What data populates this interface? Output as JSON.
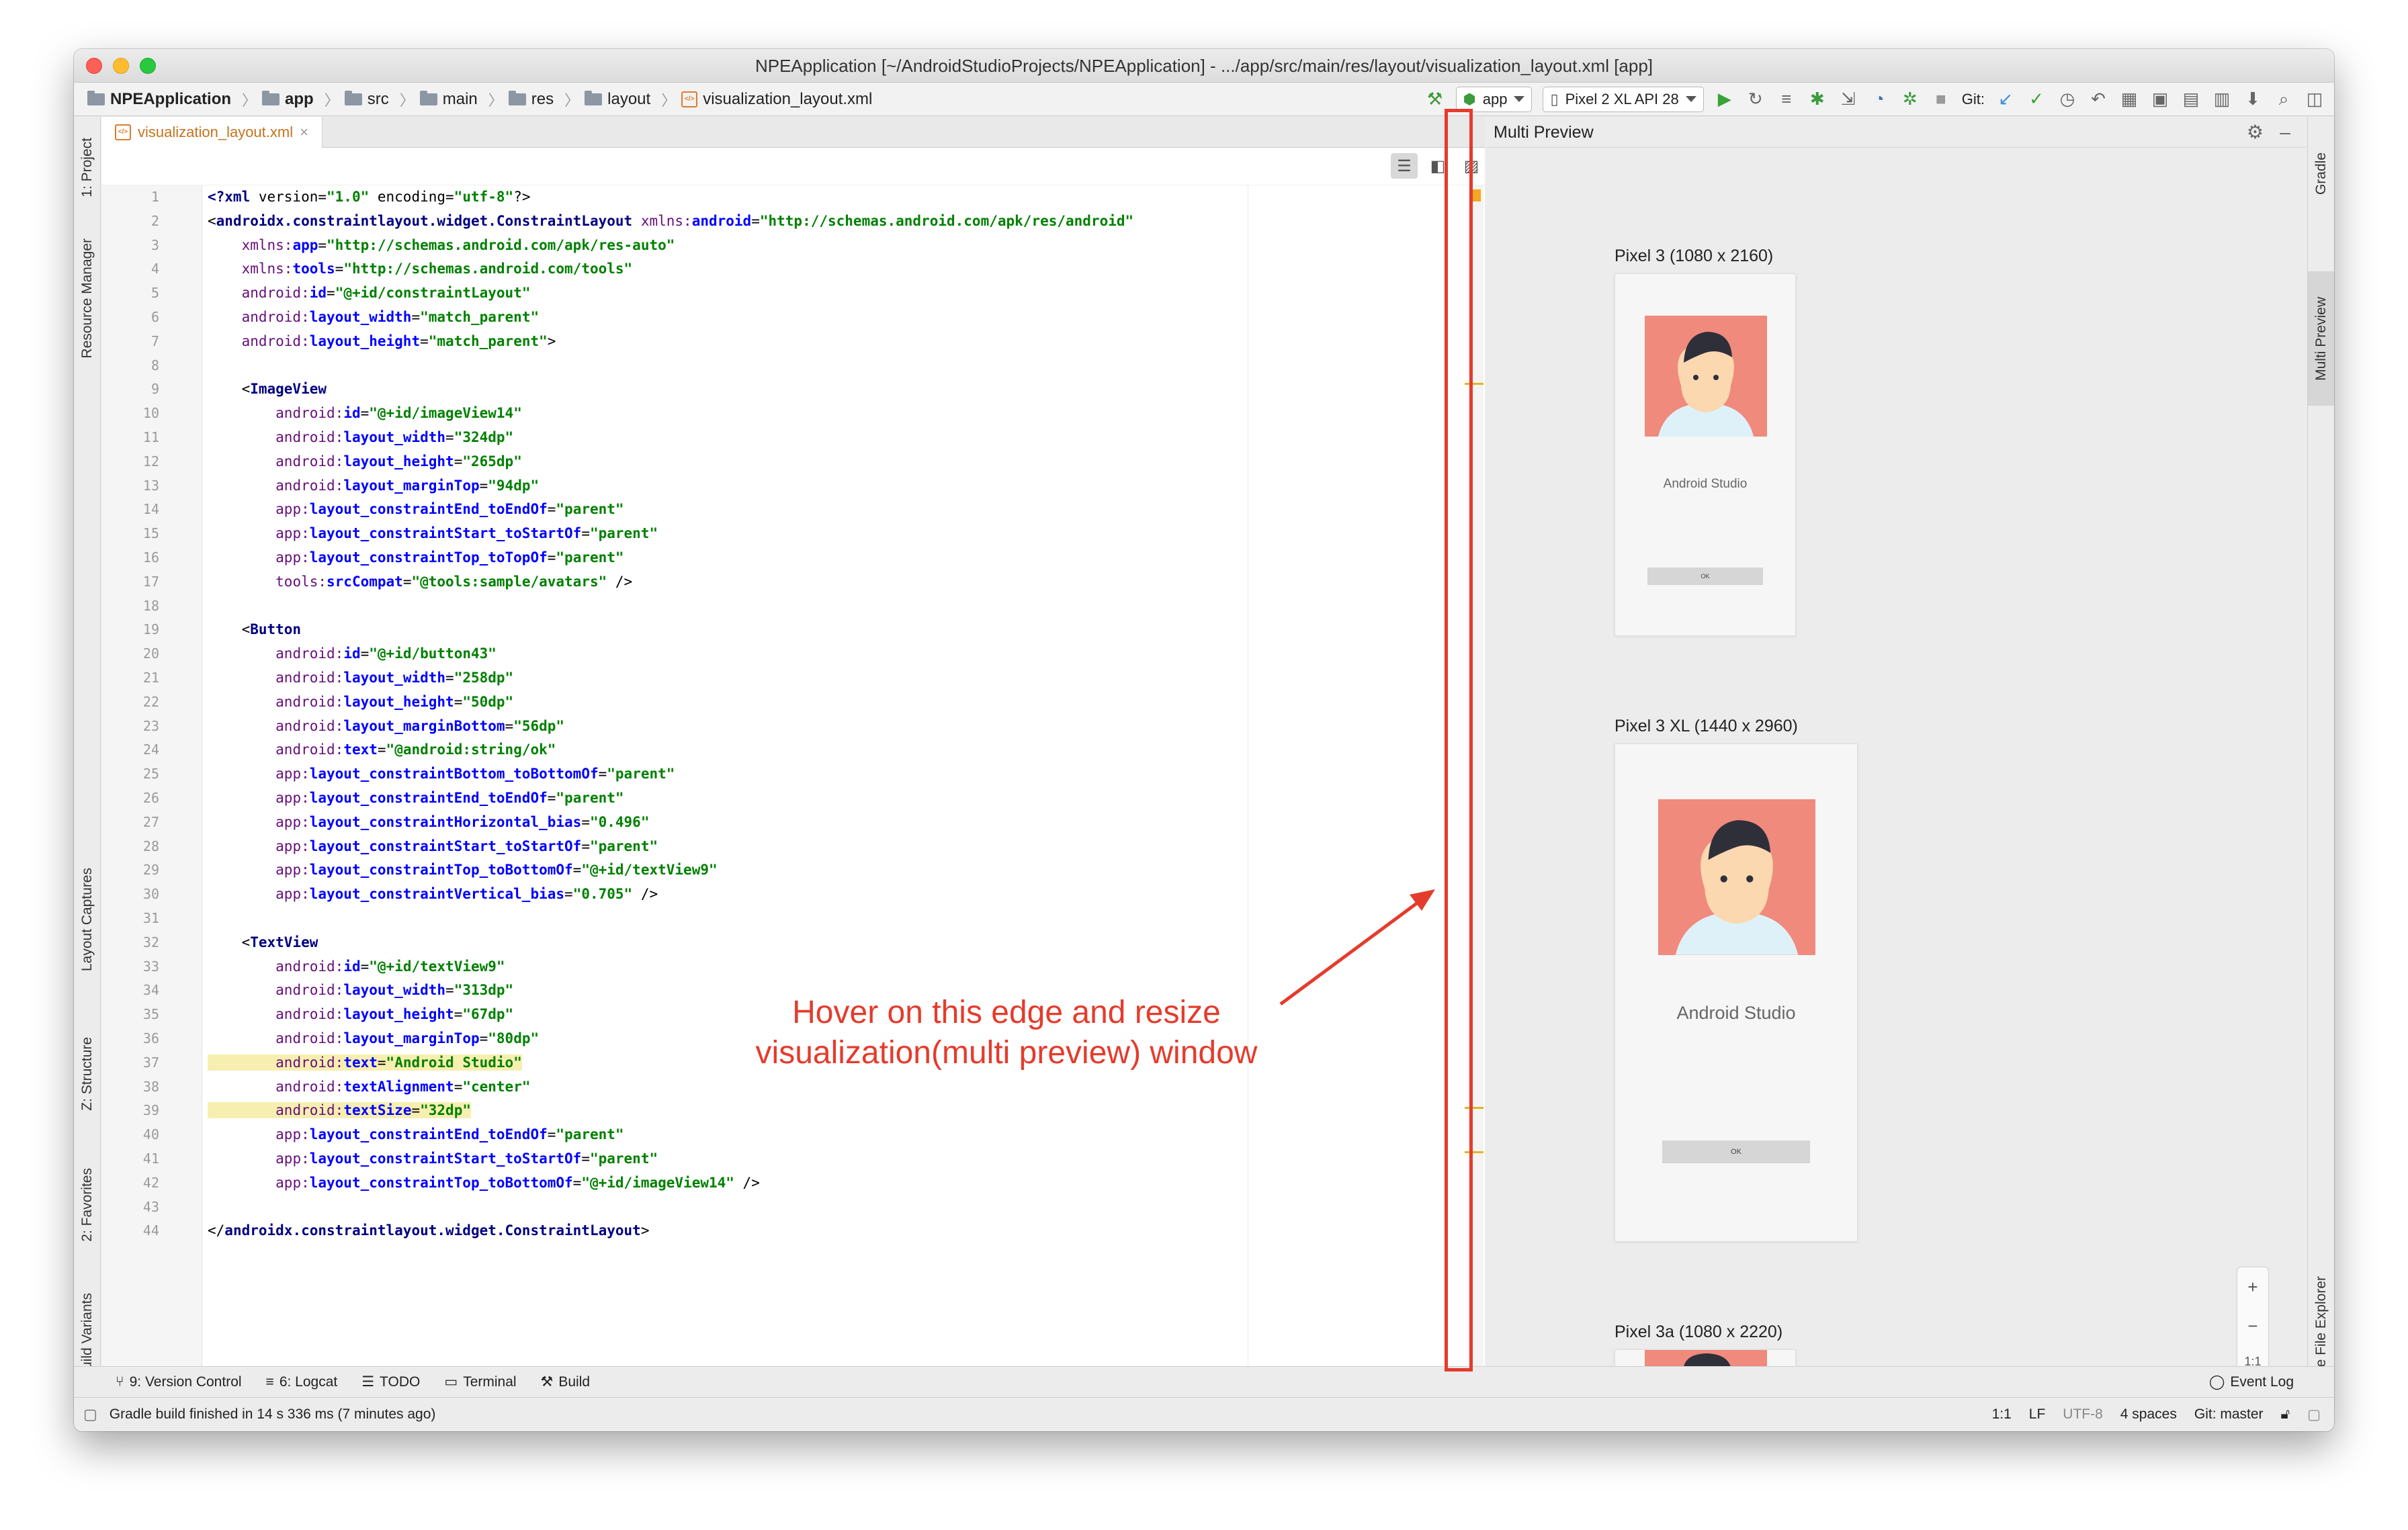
{
  "window": {
    "title": "NPEApplication [~/AndroidStudioProjects/NPEApplication] - .../app/src/main/res/layout/visualization_layout.xml [app]"
  },
  "breadcrumbs": [
    "NPEApplication",
    "app",
    "src",
    "main",
    "res",
    "layout",
    "visualization_layout.xml"
  ],
  "toolbar": {
    "run_config": "app",
    "device": "Pixel 2 XL API 28",
    "git_label": "Git:"
  },
  "left_tools": {
    "project": "1: Project",
    "resource_manager": "Resource Manager",
    "layout_captures": "Layout Captures",
    "structure": "Z: Structure",
    "favorites": "2: Favorites",
    "build_variants": "Build Variants"
  },
  "right_tools": {
    "gradle": "Gradle",
    "multi_preview": "Multi Preview",
    "device_file_explorer": "Device File Explorer"
  },
  "editor": {
    "tab": "visualization_layout.xml",
    "line_numbers": [
      "1",
      "2",
      "3",
      "4",
      "5",
      "6",
      "7",
      "8",
      "9",
      "10",
      "11",
      "12",
      "13",
      "14",
      "15",
      "16",
      "17",
      "18",
      "19",
      "20",
      "21",
      "22",
      "23",
      "24",
      "25",
      "26",
      "27",
      "28",
      "29",
      "30",
      "31",
      "32",
      "33",
      "34",
      "35",
      "36",
      "37",
      "38",
      "39",
      "40",
      "41",
      "42",
      "43",
      "44"
    ],
    "lines": [
      "<?xml version=\"1.0\" encoding=\"utf-8\"?>",
      "<androidx.constraintlayout.widget.ConstraintLayout xmlns:android=\"http://schemas.android.com/apk/res/android\"",
      "    xmlns:app=\"http://schemas.android.com/apk/res-auto\"",
      "    xmlns:tools=\"http://schemas.android.com/tools\"",
      "    android:id=\"@+id/constraintLayout\"",
      "    android:layout_width=\"match_parent\"",
      "    android:layout_height=\"match_parent\">",
      "",
      "    <ImageView",
      "        android:id=\"@+id/imageView14\"",
      "        android:layout_width=\"324dp\"",
      "        android:layout_height=\"265dp\"",
      "        android:layout_marginTop=\"94dp\"",
      "        app:layout_constraintEnd_toEndOf=\"parent\"",
      "        app:layout_constraintStart_toStartOf=\"parent\"",
      "        app:layout_constraintTop_toTopOf=\"parent\"",
      "        tools:srcCompat=\"@tools:sample/avatars\" />",
      "",
      "    <Button",
      "        android:id=\"@+id/button43\"",
      "        android:layout_width=\"258dp\"",
      "        android:layout_height=\"50dp\"",
      "        android:layout_marginBottom=\"56dp\"",
      "        android:text=\"@android:string/ok\"",
      "        app:layout_constraintBottom_toBottomOf=\"parent\"",
      "        app:layout_constraintEnd_toEndOf=\"parent\"",
      "        app:layout_constraintHorizontal_bias=\"0.496\"",
      "        app:layout_constraintStart_toStartOf=\"parent\"",
      "        app:layout_constraintTop_toBottomOf=\"@+id/textView9\"",
      "        app:layout_constraintVertical_bias=\"0.705\" />",
      "",
      "    <TextView",
      "        android:id=\"@+id/textView9\"",
      "        android:layout_width=\"313dp\"",
      "        android:layout_height=\"67dp\"",
      "        android:layout_marginTop=\"80dp\"",
      "        android:text=\"Android Studio\"",
      "        android:textAlignment=\"center\"",
      "        android:textSize=\"32dp\"",
      "        app:layout_constraintEnd_toEndOf=\"parent\"",
      "        app:layout_constraintStart_toStartOf=\"parent\"",
      "        app:layout_constraintTop_toBottomOf=\"@+id/imageView14\" />",
      "",
      "</androidx.constraintlayout.widget.ConstraintLayout>"
    ]
  },
  "preview": {
    "title": "Multi Preview",
    "devices": [
      {
        "label": "Pixel 3 (1080 x 2160)",
        "text": "Android Studio",
        "button": "OK"
      },
      {
        "label": "Pixel 3 XL (1440 x 2960)",
        "text": "Android Studio",
        "button": "OK"
      },
      {
        "label": "Pixel 3a (1080 x 2220)"
      }
    ],
    "zoom": {
      "plus": "+",
      "minus": "−",
      "one_to_one": "1:1"
    }
  },
  "bottom_tools": [
    {
      "label": "9: Version Control"
    },
    {
      "label": "6: Logcat"
    },
    {
      "label": "TODO"
    },
    {
      "label": "Terminal"
    },
    {
      "label": "Build"
    }
  ],
  "event_log": "Event Log",
  "status": {
    "message": "Gradle build finished in 14 s 336 ms (7 minutes ago)",
    "position": "1:1",
    "line_sep": "LF",
    "encoding": "UTF-8",
    "indent": "4 spaces",
    "git": "Git: master"
  },
  "annotation": "Hover on this edge and resize visualization(multi preview) window",
  "colors": {
    "annotation": "#e53b2c",
    "accent": "#3d8eda",
    "run_green": "#36a336"
  }
}
